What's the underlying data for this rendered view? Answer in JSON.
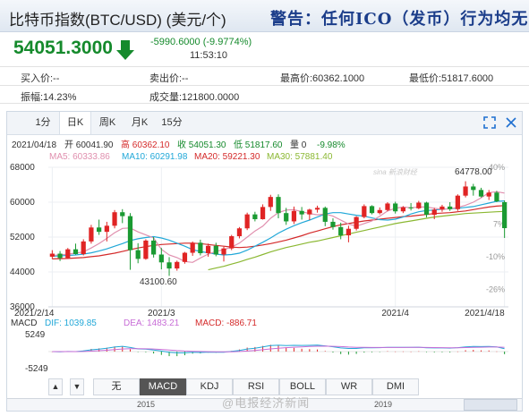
{
  "header": {
    "title": "比特币指数(BTC/USD) (美元/个)",
    "warning": "警告：任何ICO（发币）行为均无"
  },
  "quote": {
    "price": "54051.3000",
    "change": "-5990.6000 (-9.9774%)",
    "time": "11:53:10"
  },
  "stats": {
    "buy": "买入价:--",
    "sell": "卖出价:--",
    "high": "最高价:60362.1000",
    "low": "最低价:51817.6000",
    "amplitude": "振幅:14.23%",
    "volume": "成交量:121800.0000"
  },
  "tabs": [
    "1分",
    "日K",
    "周K",
    "月K",
    "15分"
  ],
  "active_tab": "日K",
  "ohlc_line": {
    "date": "2021/04/18",
    "open": "开 60041.90",
    "high": "高 60362.10",
    "close": "收 54051.30",
    "low": "低 51817.60",
    "vol": "量 0",
    "pct": "-9.98%"
  },
  "ma_line": {
    "ma5": "MA5: 60333.86",
    "ma10": "MA10: 60291.98",
    "ma20": "MA20: 59221.30",
    "ma30": "MA30: 57881.40"
  },
  "macd_line": {
    "label": "MACD",
    "dif": "DIF: 1039.85",
    "dea": "DEA: 1483.21",
    "macd": "MACD: -886.71"
  },
  "chart_data": {
    "type": "candlestick",
    "y_ticks": [
      "68000",
      "60000",
      "52000",
      "44000",
      "36000"
    ],
    "y_range": [
      36000,
      68000
    ],
    "pct_ticks": [
      "40%",
      "7%",
      "-10%",
      "-26%"
    ],
    "x_ticks": [
      "2021/2/14",
      "2021/3",
      "2021/4",
      "2021/4/18"
    ],
    "annotations": {
      "high_label": "64778.00",
      "low_label": "43100.60"
    },
    "macd_ticks": [
      "5249",
      "-5249"
    ],
    "ohlc": [
      [
        47500,
        49000,
        47000,
        48200
      ],
      [
        48200,
        48800,
        46500,
        47200
      ],
      [
        47200,
        49500,
        47000,
        49200
      ],
      [
        49200,
        50500,
        48000,
        48100
      ],
      [
        48100,
        51500,
        47800,
        51000
      ],
      [
        51000,
        54800,
        50500,
        54200
      ],
      [
        54200,
        56000,
        52500,
        53200
      ],
      [
        53200,
        55500,
        51000,
        54600
      ],
      [
        54600,
        58200,
        54000,
        57700
      ],
      [
        57700,
        58400,
        55200,
        56800
      ],
      [
        56800,
        57500,
        44500,
        49000
      ],
      [
        49000,
        50600,
        46000,
        47000
      ],
      [
        47000,
        51500,
        46800,
        51200
      ],
      [
        51200,
        52000,
        47300,
        48000
      ],
      [
        48000,
        49500,
        44600,
        46200
      ],
      [
        46200,
        47400,
        43100,
        44800
      ],
      [
        44800,
        46600,
        44300,
        46300
      ],
      [
        46300,
        48600,
        45900,
        48400
      ],
      [
        48400,
        51000,
        47700,
        50700
      ],
      [
        50700,
        51400,
        47800,
        48300
      ],
      [
        48300,
        50500,
        47500,
        50000
      ],
      [
        50000,
        50700,
        47600,
        48000
      ],
      [
        48000,
        49800,
        46400,
        49400
      ],
      [
        49400,
        52500,
        49000,
        52200
      ],
      [
        52200,
        54300,
        51700,
        54000
      ],
      [
        54000,
        57600,
        53600,
        57200
      ],
      [
        57200,
        57800,
        55600,
        56100
      ],
      [
        56100,
        59500,
        56000,
        58900
      ],
      [
        58900,
        61700,
        58000,
        61200
      ],
      [
        61200,
        61800,
        56300,
        57500
      ],
      [
        57500,
        58700,
        54800,
        55600
      ],
      [
        55600,
        59000,
        55000,
        58000
      ],
      [
        58000,
        58900,
        56000,
        57200
      ],
      [
        57200,
        58500,
        55900,
        58300
      ],
      [
        58300,
        59200,
        57600,
        58700
      ],
      [
        58700,
        59000,
        54500,
        55500
      ],
      [
        55500,
        56300,
        53700,
        54300
      ],
      [
        54300,
        55300,
        51500,
        52400
      ],
      [
        52400,
        54600,
        50800,
        53900
      ],
      [
        53900,
        56800,
        53500,
        56600
      ],
      [
        56600,
        59500,
        56300,
        59100
      ],
      [
        59100,
        59300,
        57200,
        57500
      ],
      [
        57500,
        58800,
        57200,
        58200
      ],
      [
        58200,
        60000,
        57900,
        59700
      ],
      [
        59700,
        60100,
        57400,
        57900
      ],
      [
        57900,
        59100,
        57500,
        58800
      ],
      [
        58800,
        59800,
        58100,
        58600
      ],
      [
        58600,
        60300,
        58400,
        59900
      ],
      [
        59900,
        60100,
        56500,
        57100
      ],
      [
        57100,
        58700,
        56100,
        58300
      ],
      [
        58300,
        59400,
        57800,
        59000
      ],
      [
        59000,
        60000,
        58000,
        58400
      ],
      [
        58400,
        61800,
        58000,
        61500
      ],
      [
        61500,
        64800,
        61100,
        63600
      ],
      [
        63600,
        64200,
        61500,
        62800
      ],
      [
        62800,
        63300,
        61100,
        61300
      ],
      [
        61300,
        62800,
        60500,
        62200
      ],
      [
        62200,
        62600,
        60000,
        60200
      ],
      [
        60000,
        60400,
        51800,
        54051
      ]
    ],
    "ma5": [
      47800,
      47900,
      48100,
      48300,
      48600,
      49500,
      50500,
      51700,
      53000,
      54000,
      54100,
      53200,
      52500,
      51800,
      49200,
      47900,
      47300,
      46400,
      46200,
      47200,
      48100,
      48700,
      49100,
      49700,
      50600,
      52000,
      53400,
      54500,
      56300,
      57600,
      58200,
      58300,
      57800,
      57400,
      57100,
      57300,
      56800,
      55900,
      55000,
      54500,
      55100,
      55700,
      56800,
      58000,
      58600,
      58900,
      58700,
      58900,
      58900,
      58600,
      58400,
      58500,
      58800,
      59300,
      60000,
      61000,
      62200,
      62400,
      62100
    ],
    "ma10": [
      47600,
      47700,
      47800,
      47900,
      48100,
      48400,
      48800,
      49300,
      49900,
      50500,
      51200,
      51600,
      51900,
      52100,
      51800,
      51300,
      50600,
      49900,
      49100,
      48700,
      48400,
      48100,
      47900,
      48000,
      48300,
      49000,
      49900,
      50800,
      51800,
      52900,
      53800,
      54600,
      55300,
      55900,
      56600,
      57300,
      57600,
      57600,
      57300,
      57000,
      56800,
      56400,
      56000,
      55900,
      56100,
      56600,
      57300,
      57800,
      58100,
      58200,
      58400,
      58500,
      58600,
      58800,
      59000,
      59400,
      59800,
      60200,
      60290
    ],
    "ma20": [
      47000,
      47050,
      47100,
      47200,
      47300,
      47500,
      47700,
      48000,
      48300,
      48700,
      49100,
      49500,
      49800,
      50100,
      50300,
      50400,
      50500,
      50600,
      50600,
      50500,
      50300,
      50100,
      49900,
      49700,
      49600,
      49700,
      49900,
      50200,
      50500,
      50900,
      51300,
      51800,
      52300,
      52900,
      53400,
      53900,
      54400,
      54800,
      55100,
      55400,
      55700,
      55900,
      56100,
      56300,
      56500,
      56700,
      56800,
      57000,
      57200,
      57400,
      57500,
      57600,
      57800,
      58000,
      58300,
      58600,
      58900,
      59100,
      59221
    ],
    "ma30": [
      null,
      null,
      null,
      null,
      null,
      null,
      null,
      null,
      null,
      null,
      null,
      null,
      null,
      null,
      null,
      null,
      null,
      null,
      null,
      null,
      44500,
      44900,
      45300,
      45800,
      46300,
      46900,
      47400,
      48000,
      48600,
      49100,
      49600,
      50000,
      50400,
      50800,
      51100,
      51500,
      51900,
      52300,
      52700,
      53100,
      53500,
      53900,
      54300,
      54700,
      55100,
      55400,
      55700,
      56000,
      56300,
      56600,
      56800,
      57000,
      57200,
      57400,
      57500,
      57600,
      57700,
      57800,
      57881
    ]
  },
  "bottom_tabs": [
    "无",
    "MACD",
    "KDJ",
    "RSI",
    "BOLL",
    "WR",
    "DMI"
  ],
  "active_bottom_tab": "MACD",
  "nav_buttons": [
    "▲",
    "▼"
  ],
  "footer_years": [
    "2015",
    "2019"
  ],
  "watermark": "@电报经济新闻"
}
